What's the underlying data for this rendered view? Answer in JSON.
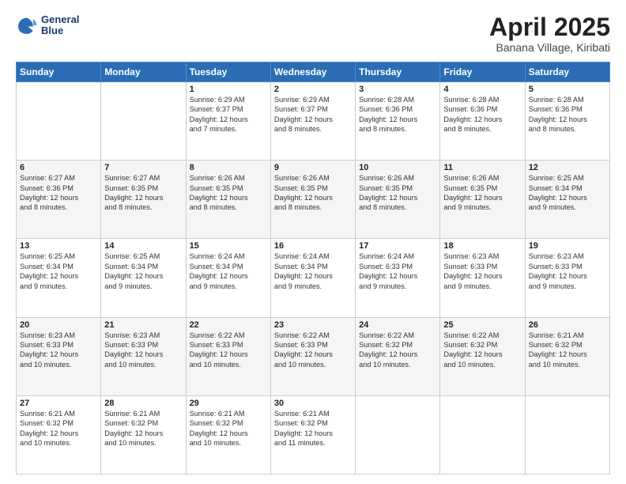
{
  "header": {
    "logo_line1": "General",
    "logo_line2": "Blue",
    "month_year": "April 2025",
    "location": "Banana Village, Kiribati"
  },
  "weekdays": [
    "Sunday",
    "Monday",
    "Tuesday",
    "Wednesday",
    "Thursday",
    "Friday",
    "Saturday"
  ],
  "weeks": [
    [
      {
        "day": "",
        "content": ""
      },
      {
        "day": "",
        "content": ""
      },
      {
        "day": "1",
        "content": "Sunrise: 6:29 AM\nSunset: 6:37 PM\nDaylight: 12 hours\nand 7 minutes."
      },
      {
        "day": "2",
        "content": "Sunrise: 6:29 AM\nSunset: 6:37 PM\nDaylight: 12 hours\nand 8 minutes."
      },
      {
        "day": "3",
        "content": "Sunrise: 6:28 AM\nSunset: 6:36 PM\nDaylight: 12 hours\nand 8 minutes."
      },
      {
        "day": "4",
        "content": "Sunrise: 6:28 AM\nSunset: 6:36 PM\nDaylight: 12 hours\nand 8 minutes."
      },
      {
        "day": "5",
        "content": "Sunrise: 6:28 AM\nSunset: 6:36 PM\nDaylight: 12 hours\nand 8 minutes."
      }
    ],
    [
      {
        "day": "6",
        "content": "Sunrise: 6:27 AM\nSunset: 6:36 PM\nDaylight: 12 hours\nand 8 minutes."
      },
      {
        "day": "7",
        "content": "Sunrise: 6:27 AM\nSunset: 6:35 PM\nDaylight: 12 hours\nand 8 minutes."
      },
      {
        "day": "8",
        "content": "Sunrise: 6:26 AM\nSunset: 6:35 PM\nDaylight: 12 hours\nand 8 minutes."
      },
      {
        "day": "9",
        "content": "Sunrise: 6:26 AM\nSunset: 6:35 PM\nDaylight: 12 hours\nand 8 minutes."
      },
      {
        "day": "10",
        "content": "Sunrise: 6:26 AM\nSunset: 6:35 PM\nDaylight: 12 hours\nand 8 minutes."
      },
      {
        "day": "11",
        "content": "Sunrise: 6:26 AM\nSunset: 6:35 PM\nDaylight: 12 hours\nand 9 minutes."
      },
      {
        "day": "12",
        "content": "Sunrise: 6:25 AM\nSunset: 6:34 PM\nDaylight: 12 hours\nand 9 minutes."
      }
    ],
    [
      {
        "day": "13",
        "content": "Sunrise: 6:25 AM\nSunset: 6:34 PM\nDaylight: 12 hours\nand 9 minutes."
      },
      {
        "day": "14",
        "content": "Sunrise: 6:25 AM\nSunset: 6:34 PM\nDaylight: 12 hours\nand 9 minutes."
      },
      {
        "day": "15",
        "content": "Sunrise: 6:24 AM\nSunset: 6:34 PM\nDaylight: 12 hours\nand 9 minutes."
      },
      {
        "day": "16",
        "content": "Sunrise: 6:24 AM\nSunset: 6:34 PM\nDaylight: 12 hours\nand 9 minutes."
      },
      {
        "day": "17",
        "content": "Sunrise: 6:24 AM\nSunset: 6:33 PM\nDaylight: 12 hours\nand 9 minutes."
      },
      {
        "day": "18",
        "content": "Sunrise: 6:23 AM\nSunset: 6:33 PM\nDaylight: 12 hours\nand 9 minutes."
      },
      {
        "day": "19",
        "content": "Sunrise: 6:23 AM\nSunset: 6:33 PM\nDaylight: 12 hours\nand 9 minutes."
      }
    ],
    [
      {
        "day": "20",
        "content": "Sunrise: 6:23 AM\nSunset: 6:33 PM\nDaylight: 12 hours\nand 10 minutes."
      },
      {
        "day": "21",
        "content": "Sunrise: 6:23 AM\nSunset: 6:33 PM\nDaylight: 12 hours\nand 10 minutes."
      },
      {
        "day": "22",
        "content": "Sunrise: 6:22 AM\nSunset: 6:33 PM\nDaylight: 12 hours\nand 10 minutes."
      },
      {
        "day": "23",
        "content": "Sunrise: 6:22 AM\nSunset: 6:33 PM\nDaylight: 12 hours\nand 10 minutes."
      },
      {
        "day": "24",
        "content": "Sunrise: 6:22 AM\nSunset: 6:32 PM\nDaylight: 12 hours\nand 10 minutes."
      },
      {
        "day": "25",
        "content": "Sunrise: 6:22 AM\nSunset: 6:32 PM\nDaylight: 12 hours\nand 10 minutes."
      },
      {
        "day": "26",
        "content": "Sunrise: 6:21 AM\nSunset: 6:32 PM\nDaylight: 12 hours\nand 10 minutes."
      }
    ],
    [
      {
        "day": "27",
        "content": "Sunrise: 6:21 AM\nSunset: 6:32 PM\nDaylight: 12 hours\nand 10 minutes."
      },
      {
        "day": "28",
        "content": "Sunrise: 6:21 AM\nSunset: 6:32 PM\nDaylight: 12 hours\nand 10 minutes."
      },
      {
        "day": "29",
        "content": "Sunrise: 6:21 AM\nSunset: 6:32 PM\nDaylight: 12 hours\nand 10 minutes."
      },
      {
        "day": "30",
        "content": "Sunrise: 6:21 AM\nSunset: 6:32 PM\nDaylight: 12 hours\nand 11 minutes."
      },
      {
        "day": "",
        "content": ""
      },
      {
        "day": "",
        "content": ""
      },
      {
        "day": "",
        "content": ""
      }
    ]
  ]
}
